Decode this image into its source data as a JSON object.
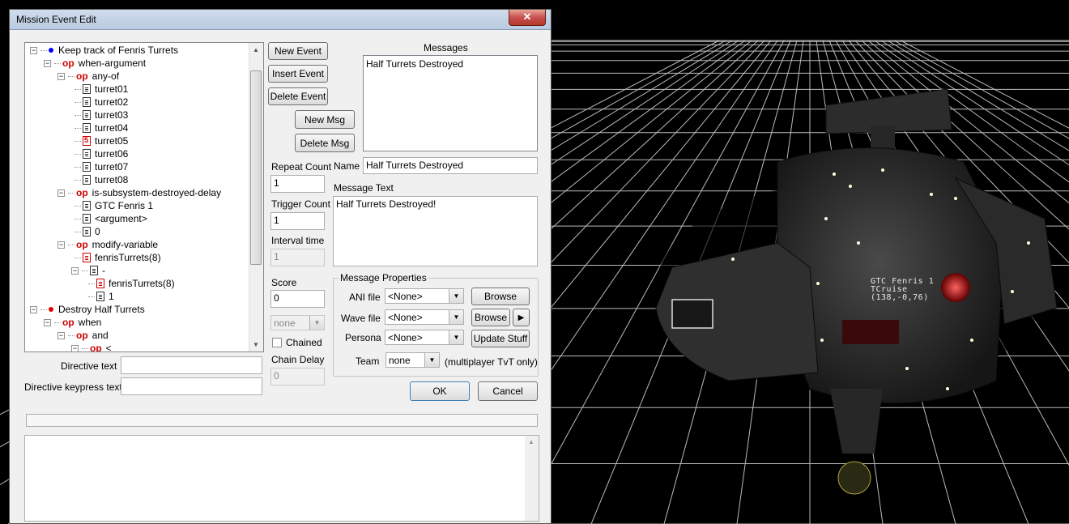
{
  "window": {
    "title": "Mission Event Edit",
    "close_glyph": "✕"
  },
  "tree": {
    "nodes": [
      {
        "depth": 0,
        "type": "event",
        "label": "Keep track of Fenris Turrets",
        "dot_color": "#0000ff",
        "expander": "−"
      },
      {
        "depth": 1,
        "type": "op",
        "label": "when-argument",
        "expander": "−"
      },
      {
        "depth": 2,
        "type": "op",
        "label": "any-of",
        "expander": "−"
      },
      {
        "depth": 3,
        "type": "data",
        "label": "turret01"
      },
      {
        "depth": 3,
        "type": "data",
        "label": "turret02"
      },
      {
        "depth": 3,
        "type": "data",
        "label": "turret03"
      },
      {
        "depth": 3,
        "type": "data",
        "label": "turret04"
      },
      {
        "depth": 3,
        "type": "data5",
        "label": "turret05",
        "glyph": "5"
      },
      {
        "depth": 3,
        "type": "data",
        "label": "turret06"
      },
      {
        "depth": 3,
        "type": "data",
        "label": "turret07"
      },
      {
        "depth": 3,
        "type": "data",
        "label": "turret08"
      },
      {
        "depth": 2,
        "type": "op",
        "label": "is-subsystem-destroyed-delay",
        "expander": "−"
      },
      {
        "depth": 3,
        "type": "data",
        "label": "GTC Fenris 1"
      },
      {
        "depth": 3,
        "type": "data",
        "label": "<argument>"
      },
      {
        "depth": 3,
        "type": "data",
        "label": "0"
      },
      {
        "depth": 2,
        "type": "op",
        "label": "modify-variable",
        "expander": "−"
      },
      {
        "depth": 3,
        "type": "datared",
        "label": "fenrisTurrets(8)"
      },
      {
        "depth": 3,
        "type": "data",
        "label": "-",
        "expander": "−"
      },
      {
        "depth": 4,
        "type": "datared",
        "label": "fenrisTurrets(8)"
      },
      {
        "depth": 4,
        "type": "data",
        "label": "1"
      },
      {
        "depth": 0,
        "type": "event",
        "label": "Destroy Half Turrets",
        "dot_color": "#e00000",
        "expander": "−"
      },
      {
        "depth": 1,
        "type": "op",
        "label": "when",
        "expander": "−"
      },
      {
        "depth": 2,
        "type": "op",
        "label": "and",
        "expander": "−"
      },
      {
        "depth": 3,
        "type": "op",
        "label": "<",
        "expander": "−"
      }
    ],
    "op_label": "op"
  },
  "buttons": {
    "new_event": "New Event",
    "insert_event": "Insert Event",
    "delete_event": "Delete Event",
    "new_msg": "New Msg",
    "delete_msg": "Delete Msg",
    "browse_ani": "Browse",
    "browse_wave": "Browse",
    "play_wave": "▶",
    "update_stuff": "Update Stuff",
    "ok": "OK",
    "cancel": "Cancel"
  },
  "messages": {
    "label": "Messages",
    "items": [
      "Half Turrets Destroyed"
    ]
  },
  "event_fields": {
    "repeat_count_label": "Repeat Count",
    "repeat_count": "1",
    "trigger_count_label": "Trigger Count",
    "trigger_count": "1",
    "interval_label": "Interval time",
    "interval": "1",
    "score_label": "Score",
    "score": "0",
    "team_combo": "none",
    "chained_label": "Chained",
    "chain_delay_label": "Chain Delay",
    "chain_delay": "0"
  },
  "message_fields": {
    "name_label": "Name",
    "name": "Half Turrets Destroyed",
    "text_label": "Message Text",
    "text": "Half Turrets Destroyed!"
  },
  "message_properties": {
    "title": "Message Properties",
    "ani_label": "ANI file",
    "ani_value": "<None>",
    "wave_label": "Wave file",
    "wave_value": "<None>",
    "persona_label": "Persona",
    "persona_value": "<None>",
    "team_label": "Team",
    "team_value": "none",
    "team_note": "(multiplayer TvT only)"
  },
  "directive": {
    "text_label": "Directive text",
    "text_value": "",
    "keypress_label": "Directive keypress text",
    "keypress_value": ""
  },
  "viewport": {
    "ship_label": [
      "GTC Fenris 1",
      "TCruise",
      "(138,-0,76)"
    ]
  }
}
